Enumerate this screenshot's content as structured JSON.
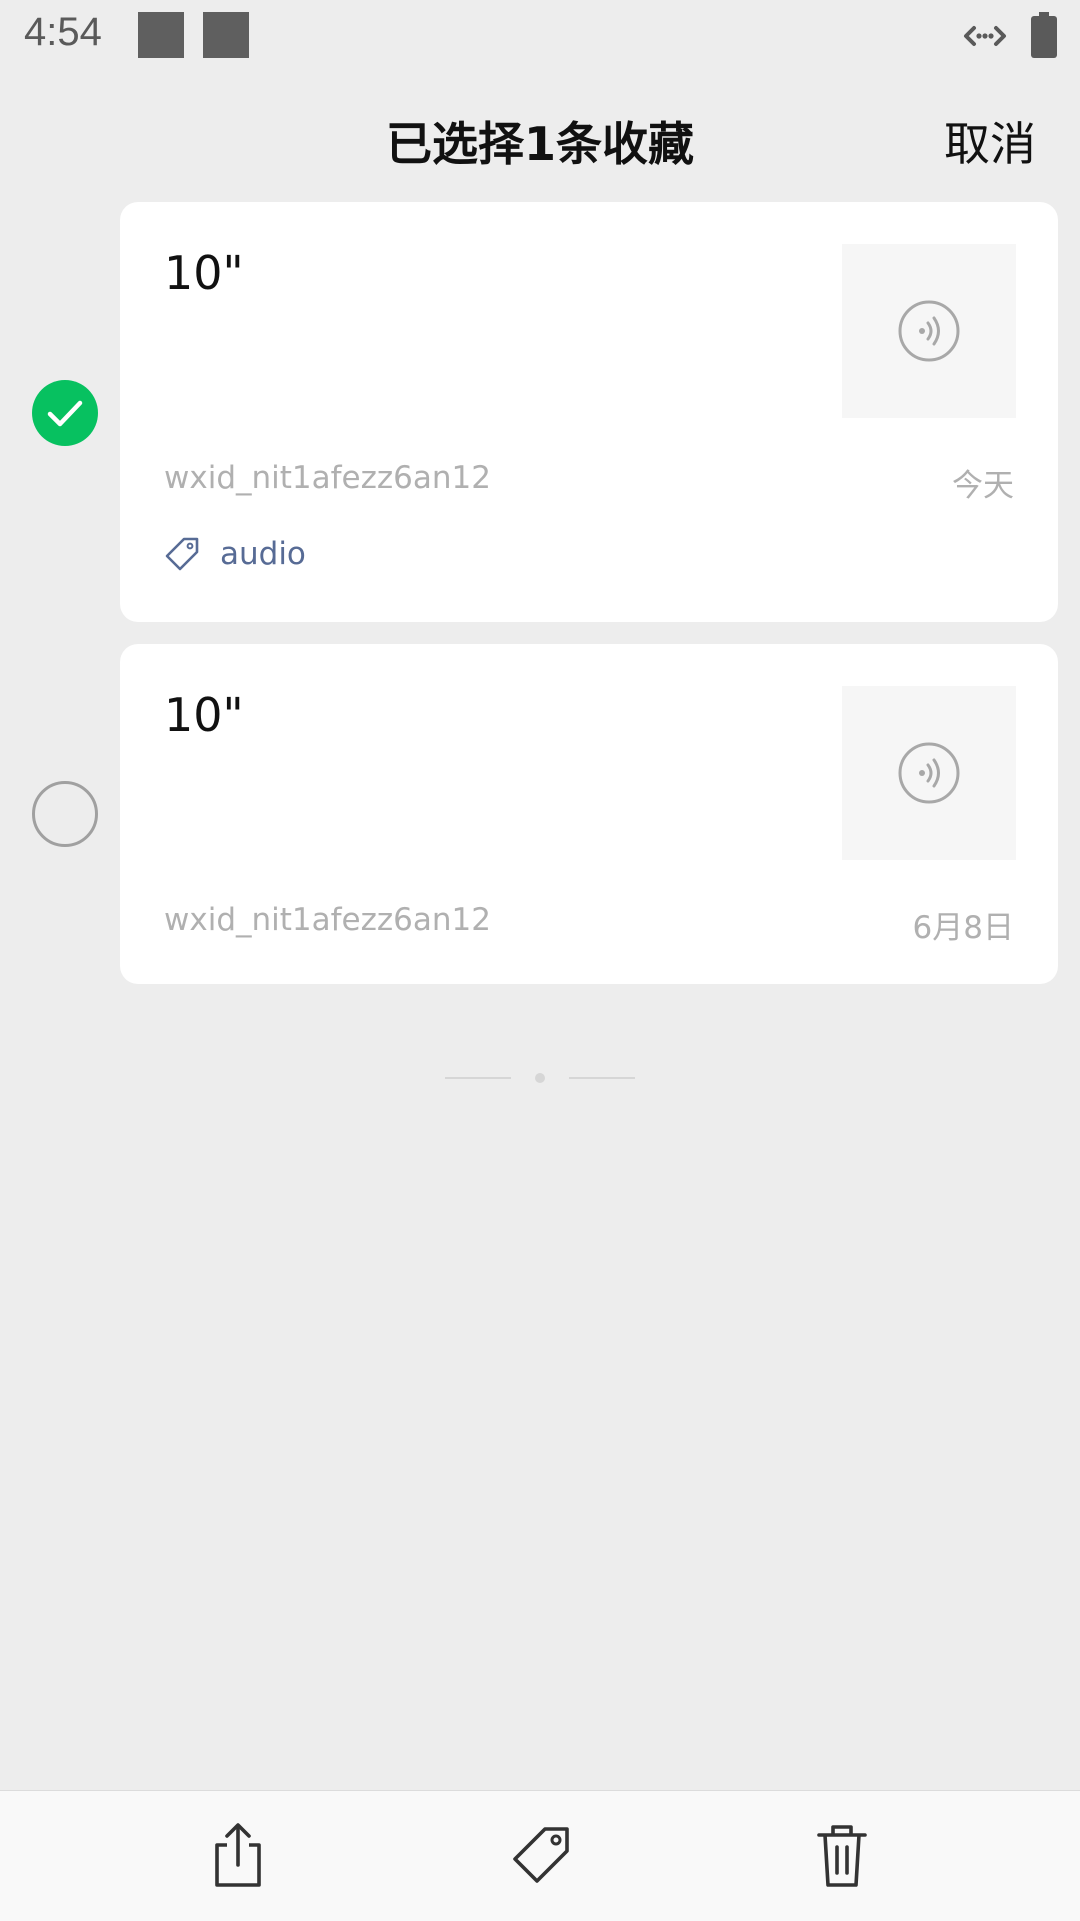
{
  "status_bar": {
    "time": "4:54",
    "icons": [
      "notification-square",
      "notification-square",
      "sync-icon",
      "battery-icon"
    ]
  },
  "header": {
    "title": "已选择1条收藏",
    "cancel_label": "取消"
  },
  "items": [
    {
      "title": "10\"",
      "source": "wxid_nit1afezz6an12",
      "date": "今天",
      "tag": "audio",
      "selected": true,
      "thumbnail_icon": "voice-icon"
    },
    {
      "title": "10\"",
      "source": "wxid_nit1afezz6an12",
      "date": "6月8日",
      "selected": false,
      "thumbnail_icon": "voice-icon"
    }
  ],
  "toolbar": {
    "buttons": [
      "share-icon",
      "tag-icon",
      "trash-icon"
    ]
  },
  "colors": {
    "accent_green": "#07c160",
    "tag_text": "#576b95",
    "background": "#ededed",
    "meta_text": "#b0b0b0"
  }
}
